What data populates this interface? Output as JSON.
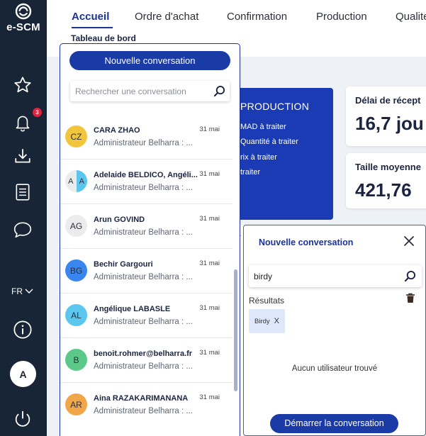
{
  "app": {
    "logo_text": "e-SCM"
  },
  "sidebar": {
    "notification_count": "3",
    "language": "FR",
    "user_initial": "A"
  },
  "nav": {
    "tabs": [
      {
        "label": "Accueil"
      },
      {
        "label": "Ordre d'achat"
      },
      {
        "label": "Confirmation"
      },
      {
        "label": "Production"
      },
      {
        "label": "Qualite"
      }
    ],
    "breadcrumb": "Tableau de bord"
  },
  "dashboard": {
    "production_card": {
      "title": "PRODUCTION",
      "lines": [
        "MAD à traiter",
        "Quantité à traiter",
        "rix à traiter",
        "traiter"
      ]
    },
    "kpi1": {
      "label": "Délai de récept",
      "value": "16,7 jou"
    },
    "kpi2": {
      "label": "Taille moyenne",
      "value": "421,76"
    },
    "stray_letter": "a"
  },
  "conversations": {
    "new_button": "Nouvelle conversation",
    "search_placeholder": "Rechercher une conversation",
    "items": [
      {
        "initials": "CZ",
        "avatar_color": "#f2c53d",
        "name": "CARA ZHAO",
        "preview": "Administrateur Belharra : ...",
        "date": "31 mai"
      },
      {
        "initials_left": "A",
        "initials_right": "A",
        "avatar_left_color": "#ececec",
        "avatar_right_color": "#5bc6ee",
        "name": "Adelaide BELDICO, Angéli...",
        "preview": "Administrateur Belharra : ...",
        "date": "31 mai"
      },
      {
        "initials": "AG",
        "avatar_color": "#ececec",
        "name": "Arun GOVIND",
        "preview": "Administrateur Belharra : ...",
        "date": "31 mai"
      },
      {
        "initials": "BG",
        "avatar_color": "#3a86f0",
        "name": "Bechir Gargouri",
        "preview": "Administrateur Belharra : ...",
        "date": "31 mai"
      },
      {
        "initials": "AL",
        "avatar_color": "#5bc6ee",
        "name": "Angélique LABASLE",
        "preview": "Administrateur Belharra : ...",
        "date": "31 mai"
      },
      {
        "initials": "B",
        "avatar_color": "#5cc98a",
        "name": "benoit.rohmer@belharra.fr",
        "preview": "Administrateur Belharra : ...",
        "date": "31 mai"
      },
      {
        "initials": "AR",
        "avatar_color": "#f2a64a",
        "name": "Aina RAZAKARIMANANA",
        "preview": "Administrateur Belharra : ...",
        "date": "31 mai"
      }
    ]
  },
  "new_conversation_modal": {
    "title": "Nouvelle conversation",
    "search_value": "birdy",
    "results_label": "Résultats",
    "chip_label": "Birdy",
    "chip_remove": "X",
    "empty_message": "Aucun utilisateur trouvé",
    "start_button": "Démarrer la conversation"
  },
  "colors": {
    "sidebar_bg": "#172536",
    "primary": "#1a3ba6",
    "accent_text": "#1a3399",
    "production_card": "#1a3bb3",
    "badge": "#e2213f"
  }
}
